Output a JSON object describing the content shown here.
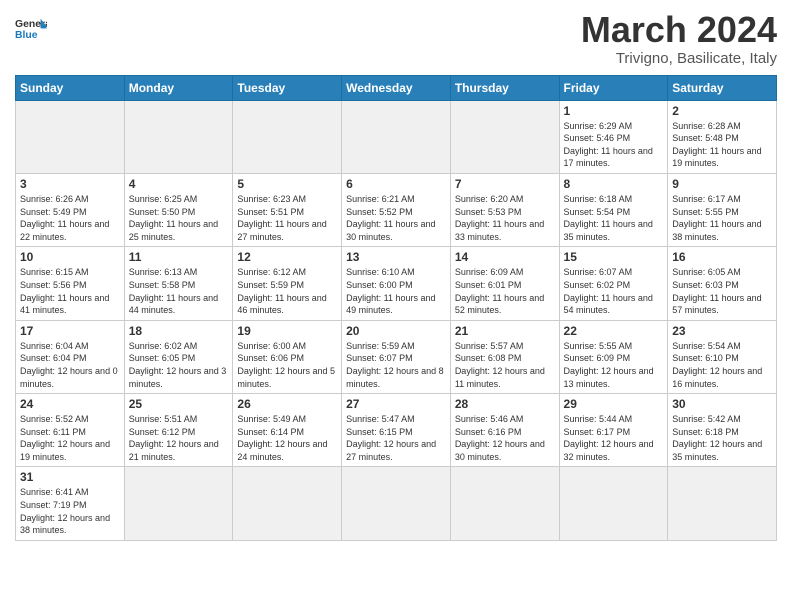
{
  "logo": {
    "text_general": "General",
    "text_blue": "Blue"
  },
  "header": {
    "month": "March 2024",
    "location": "Trivigno, Basilicate, Italy"
  },
  "weekdays": [
    "Sunday",
    "Monday",
    "Tuesday",
    "Wednesday",
    "Thursday",
    "Friday",
    "Saturday"
  ],
  "days": {
    "1": {
      "num": "1",
      "sunrise": "6:29 AM",
      "sunset": "5:46 PM",
      "daylight": "11 hours and 17 minutes."
    },
    "2": {
      "num": "2",
      "sunrise": "6:28 AM",
      "sunset": "5:48 PM",
      "daylight": "11 hours and 19 minutes."
    },
    "3": {
      "num": "3",
      "sunrise": "6:26 AM",
      "sunset": "5:49 PM",
      "daylight": "11 hours and 22 minutes."
    },
    "4": {
      "num": "4",
      "sunrise": "6:25 AM",
      "sunset": "5:50 PM",
      "daylight": "11 hours and 25 minutes."
    },
    "5": {
      "num": "5",
      "sunrise": "6:23 AM",
      "sunset": "5:51 PM",
      "daylight": "11 hours and 27 minutes."
    },
    "6": {
      "num": "6",
      "sunrise": "6:21 AM",
      "sunset": "5:52 PM",
      "daylight": "11 hours and 30 minutes."
    },
    "7": {
      "num": "7",
      "sunrise": "6:20 AM",
      "sunset": "5:53 PM",
      "daylight": "11 hours and 33 minutes."
    },
    "8": {
      "num": "8",
      "sunrise": "6:18 AM",
      "sunset": "5:54 PM",
      "daylight": "11 hours and 35 minutes."
    },
    "9": {
      "num": "9",
      "sunrise": "6:17 AM",
      "sunset": "5:55 PM",
      "daylight": "11 hours and 38 minutes."
    },
    "10": {
      "num": "10",
      "sunrise": "6:15 AM",
      "sunset": "5:56 PM",
      "daylight": "11 hours and 41 minutes."
    },
    "11": {
      "num": "11",
      "sunrise": "6:13 AM",
      "sunset": "5:58 PM",
      "daylight": "11 hours and 44 minutes."
    },
    "12": {
      "num": "12",
      "sunrise": "6:12 AM",
      "sunset": "5:59 PM",
      "daylight": "11 hours and 46 minutes."
    },
    "13": {
      "num": "13",
      "sunrise": "6:10 AM",
      "sunset": "6:00 PM",
      "daylight": "11 hours and 49 minutes."
    },
    "14": {
      "num": "14",
      "sunrise": "6:09 AM",
      "sunset": "6:01 PM",
      "daylight": "11 hours and 52 minutes."
    },
    "15": {
      "num": "15",
      "sunrise": "6:07 AM",
      "sunset": "6:02 PM",
      "daylight": "11 hours and 54 minutes."
    },
    "16": {
      "num": "16",
      "sunrise": "6:05 AM",
      "sunset": "6:03 PM",
      "daylight": "11 hours and 57 minutes."
    },
    "17": {
      "num": "17",
      "sunrise": "6:04 AM",
      "sunset": "6:04 PM",
      "daylight": "12 hours and 0 minutes."
    },
    "18": {
      "num": "18",
      "sunrise": "6:02 AM",
      "sunset": "6:05 PM",
      "daylight": "12 hours and 3 minutes."
    },
    "19": {
      "num": "19",
      "sunrise": "6:00 AM",
      "sunset": "6:06 PM",
      "daylight": "12 hours and 5 minutes."
    },
    "20": {
      "num": "20",
      "sunrise": "5:59 AM",
      "sunset": "6:07 PM",
      "daylight": "12 hours and 8 minutes."
    },
    "21": {
      "num": "21",
      "sunrise": "5:57 AM",
      "sunset": "6:08 PM",
      "daylight": "12 hours and 11 minutes."
    },
    "22": {
      "num": "22",
      "sunrise": "5:55 AM",
      "sunset": "6:09 PM",
      "daylight": "12 hours and 13 minutes."
    },
    "23": {
      "num": "23",
      "sunrise": "5:54 AM",
      "sunset": "6:10 PM",
      "daylight": "12 hours and 16 minutes."
    },
    "24": {
      "num": "24",
      "sunrise": "5:52 AM",
      "sunset": "6:11 PM",
      "daylight": "12 hours and 19 minutes."
    },
    "25": {
      "num": "25",
      "sunrise": "5:51 AM",
      "sunset": "6:12 PM",
      "daylight": "12 hours and 21 minutes."
    },
    "26": {
      "num": "26",
      "sunrise": "5:49 AM",
      "sunset": "6:14 PM",
      "daylight": "12 hours and 24 minutes."
    },
    "27": {
      "num": "27",
      "sunrise": "5:47 AM",
      "sunset": "6:15 PM",
      "daylight": "12 hours and 27 minutes."
    },
    "28": {
      "num": "28",
      "sunrise": "5:46 AM",
      "sunset": "6:16 PM",
      "daylight": "12 hours and 30 minutes."
    },
    "29": {
      "num": "29",
      "sunrise": "5:44 AM",
      "sunset": "6:17 PM",
      "daylight": "12 hours and 32 minutes."
    },
    "30": {
      "num": "30",
      "sunrise": "5:42 AM",
      "sunset": "6:18 PM",
      "daylight": "12 hours and 35 minutes."
    },
    "31": {
      "num": "31",
      "sunrise": "6:41 AM",
      "sunset": "7:19 PM",
      "daylight": "12 hours and 38 minutes."
    }
  }
}
